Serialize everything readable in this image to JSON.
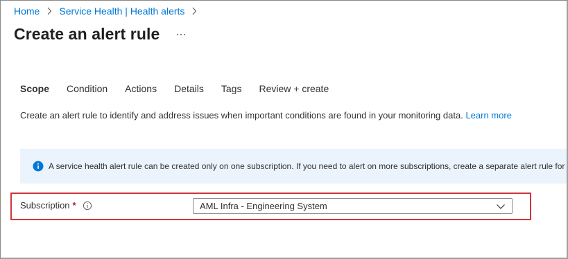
{
  "breadcrumb": {
    "items": [
      "Home",
      "Service Health | Health alerts"
    ]
  },
  "header": {
    "title": "Create an alert rule",
    "more_label": "···"
  },
  "tabs": [
    {
      "label": "Scope",
      "active": true
    },
    {
      "label": "Condition",
      "active": false
    },
    {
      "label": "Actions",
      "active": false
    },
    {
      "label": "Details",
      "active": false
    },
    {
      "label": "Tags",
      "active": false
    },
    {
      "label": "Review + create",
      "active": false
    }
  ],
  "description": {
    "text": "Create an alert rule to identify and address issues when important conditions are found in your monitoring data.",
    "link": "Learn more"
  },
  "info_banner": {
    "icon": "info-icon",
    "text": "A service health alert rule can be created only on one subscription. If you need to alert on more subscriptions, create a separate alert rule for e"
  },
  "subscription": {
    "label": "Subscription",
    "required_marker": "*",
    "selected_value": "AML Infra - Engineering System"
  },
  "colors": {
    "accent": "#0078d4",
    "highlight": "#d13438",
    "banner_bg": "#ebf3fc"
  }
}
